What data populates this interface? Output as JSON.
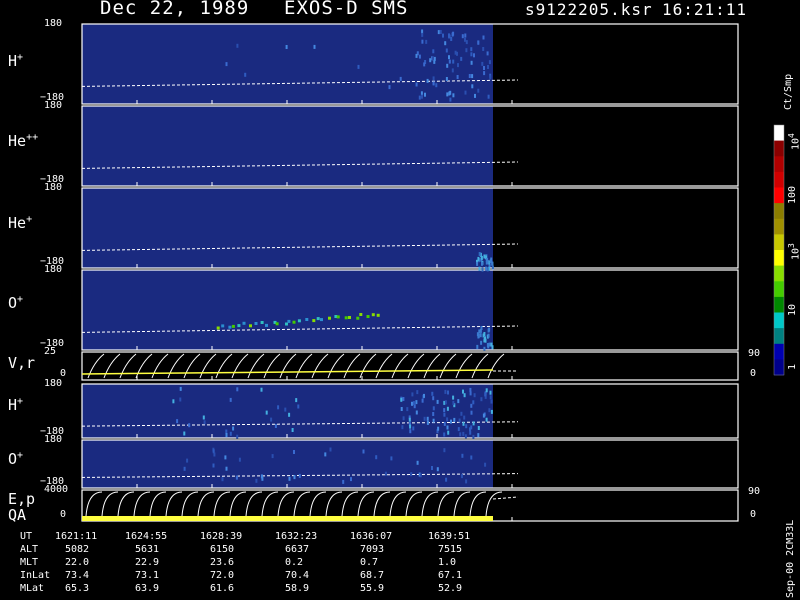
{
  "header": {
    "date": "Dec 22, 1989",
    "instrument": "EXOS-D SMS",
    "file": "s9122205.ksr",
    "time": "16:21:11"
  },
  "colorbar": {
    "unit": "Ct/Smp",
    "ticks": [
      "10",
      "100",
      "10",
      "10",
      "1"
    ],
    "tick_exponents": [
      "4",
      "",
      "3",
      "",
      ""
    ],
    "colors": [
      "#ffffff",
      "#8b0000",
      "#b00000",
      "#d00000",
      "#ff0000",
      "#8b7d00",
      "#a09000",
      "#c8c800",
      "#ffff00",
      "#88dd00",
      "#44cc00",
      "#008800",
      "#00c8c8",
      "#008080",
      "#0000b0",
      "#00008b"
    ]
  },
  "chart_data": {
    "type": "heatmap",
    "description_time_axis": "UT",
    "x": [
      "1621:11",
      "1624:55",
      "1628:39",
      "1632:23",
      "1636:07",
      "1639:51"
    ],
    "panels": [
      {
        "label": "H",
        "charge": "+",
        "ytop": "180",
        "ybot": "−180",
        "type": "heatmap"
      },
      {
        "label": "He",
        "charge": "++",
        "ytop": "180",
        "ybot": "−180",
        "type": "heatmap"
      },
      {
        "label": "He",
        "charge": "+",
        "ytop": "180",
        "ybot": "−180",
        "type": "heatmap"
      },
      {
        "label": "O",
        "charge": "+",
        "ytop": "180",
        "ybot": "−180",
        "type": "heatmap"
      },
      {
        "label": "V,r",
        "charge": "",
        "ytop": "25",
        "ybot": "0",
        "rtop": "90",
        "rbot": "0",
        "type": "line"
      },
      {
        "label": "H",
        "charge": "+",
        "ytop": "180",
        "ybot": "−180",
        "type": "heatmap"
      },
      {
        "label": "O",
        "charge": "+",
        "ytop": "180",
        "ybot": "−180",
        "type": "heatmap"
      },
      {
        "label": "E,p",
        "label2": "QA",
        "charge": "",
        "ytop": "4000",
        "ybot": "0",
        "rtop": "90",
        "rbot": "0",
        "type": "line"
      }
    ],
    "table": {
      "rows": [
        {
          "name": "UT",
          "values": [
            "1621:11",
            "1624:55",
            "1628:39",
            "1632:23",
            "1636:07",
            "1639:51"
          ]
        },
        {
          "name": "ALT",
          "values": [
            "5082",
            "5631",
            "6150",
            "6637",
            "7093",
            "7515"
          ]
        },
        {
          "name": "MLT",
          "values": [
            "22.0",
            "22.9",
            "23.6",
            "0.2",
            "0.7",
            "1.0"
          ]
        },
        {
          "name": "InLat",
          "values": [
            "73.4",
            "73.1",
            "72.0",
            "70.4",
            "68.7",
            "67.1"
          ]
        },
        {
          "name": "MLat",
          "values": [
            "65.3",
            "63.9",
            "61.6",
            "58.9",
            "55.9",
            "52.9"
          ]
        }
      ]
    }
  },
  "footer": {
    "tag": "Sep-00  2CM33L"
  }
}
